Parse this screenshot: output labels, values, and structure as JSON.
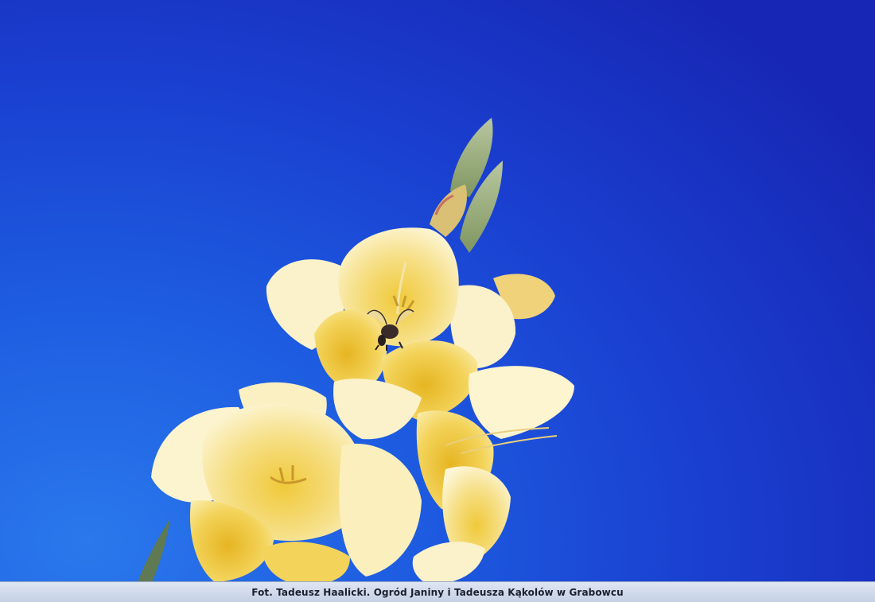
{
  "photo": {
    "subject": "yellow-gladiolus-flower-with-bee",
    "colors": {
      "sky_light": "#2a78ec",
      "sky_dark": "#1726b4",
      "petal_cream": "#fbf2c6",
      "petal_yellow": "#f1cc3a",
      "bud_green": "#8fa56a"
    }
  },
  "caption": {
    "text": "Fot. Tadeusz Haalicki. Ogród Janiny i Tadeusza Kąkolów w Grabowcu"
  }
}
